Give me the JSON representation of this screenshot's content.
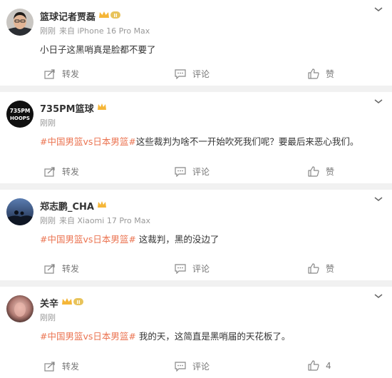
{
  "posts": [
    {
      "user": "篮球记者贾磊",
      "badge": "II",
      "time": "刚刚",
      "source": "来自 iPhone 16 Pro Max",
      "topic": "",
      "text": "小日子这黑哨真是脸都不要了",
      "repost_label": "转发",
      "comment_label": "评论",
      "like_label": "赞"
    },
    {
      "user": "735PM篮球",
      "avatar_text_1": "735PM",
      "avatar_text_2": "HOOPS",
      "time": "刚刚",
      "source": "",
      "topic": "#中国男篮vs日本男篮#",
      "text": "这些裁判为啥不一开始吹死我们呢？要最后来恶心我们。",
      "repost_label": "转发",
      "comment_label": "评论",
      "like_label": "赞"
    },
    {
      "user": "郑志鹏_CHA",
      "time": "刚刚",
      "source": "来自 Xiaomi 17 Pro Max",
      "topic": "#中国男篮vs日本男篮#",
      "text": " 这裁判，黑的没边了",
      "repost_label": "转发",
      "comment_label": "评论",
      "like_label": "赞"
    },
    {
      "user": "关辛",
      "badge": "II",
      "time": "刚刚",
      "source": "",
      "topic": "#中国男篮vs日本男篮#",
      "text": " 我的天，这简直是黑哨届的天花板了。",
      "repost_label": "转发",
      "comment_label": "评论",
      "like_label": "4"
    }
  ],
  "colors": {
    "topic": "#eb7350",
    "meta": "#999999",
    "crown": "#f5b638",
    "background": "#f1f1f1"
  },
  "icons": [
    "chevron-down-icon",
    "repost-icon",
    "comment-icon",
    "like-icon",
    "crown-badge-icon"
  ]
}
